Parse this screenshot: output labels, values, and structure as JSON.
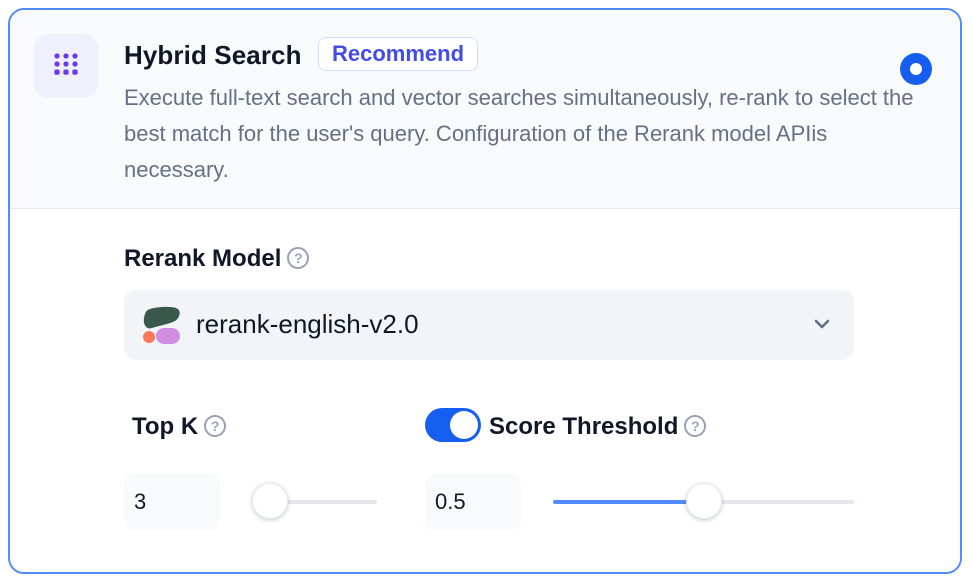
{
  "header": {
    "icon": "grid-dots-icon",
    "title": "Hybrid Search",
    "badge": "Recommend",
    "description": "Execute full-text search and vector searches simultaneously, re-rank to select the best match for the user's query. Configuration of the Rerank model APIis necessary.",
    "selected": true
  },
  "rerank": {
    "label": "Rerank Model",
    "help_icon": "question-circle-icon",
    "model_name": "rerank-english-v2.0",
    "model_icon": "cohere-logo-icon",
    "dropdown_icon": "chevron-down-icon"
  },
  "top_k": {
    "label": "Top K",
    "value": "3",
    "slider_fraction": 0.08
  },
  "score_threshold": {
    "label": "Score Threshold",
    "enabled": true,
    "value": "0.5",
    "slider_fraction": 0.5
  },
  "colors": {
    "accent": "#155eef",
    "slider_fill": "#528bff",
    "badge_text": "#444ce7"
  }
}
